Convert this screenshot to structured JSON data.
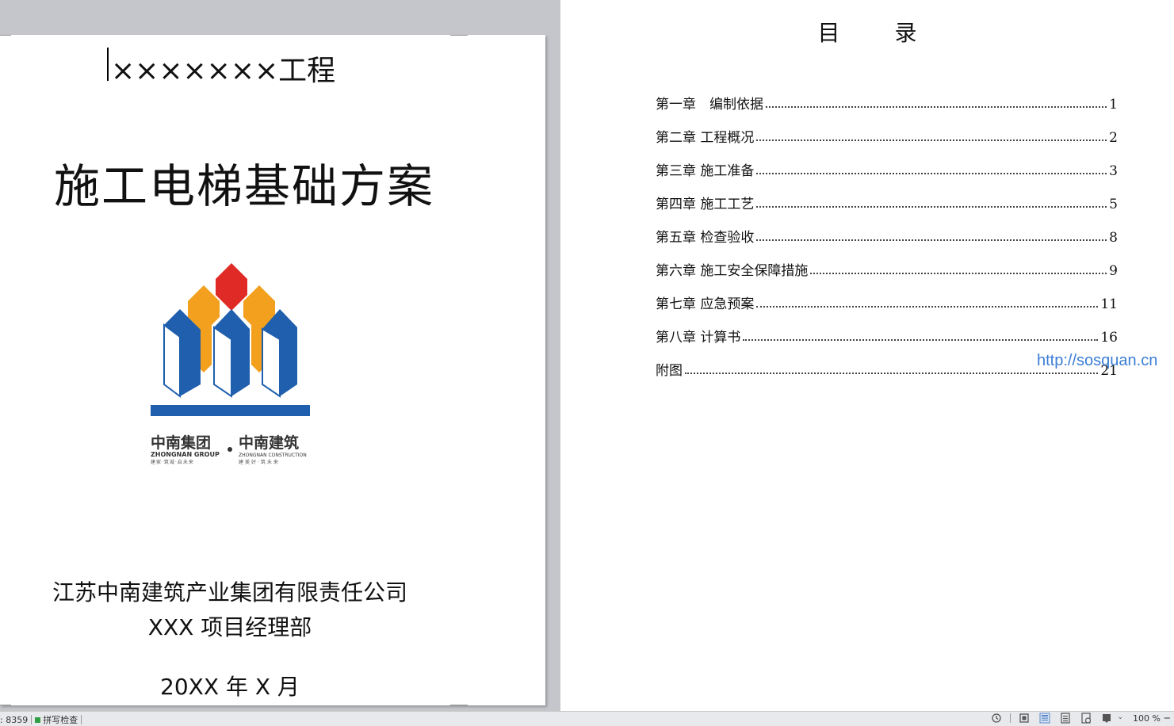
{
  "cover": {
    "project": "×××××××工程",
    "title": "施工电梯基础方案",
    "company": "江苏中南建筑产业集团有限责任公司",
    "department": "XXX 项目经理部",
    "date": "20XX 年 X 月",
    "logo": {
      "group_cn": "中南集团",
      "group_en": "ZHONGNAN GROUP",
      "group_slogan": "建家·筑城·启未来",
      "construction_cn": "中南建筑",
      "construction_en": "ZHONGNAN CONSTRUCTION",
      "construction_slogan": "建美好·筑未来",
      "colors": {
        "blue": "#1f5fad",
        "orange": "#f2a01e",
        "red": "#e02a26"
      }
    }
  },
  "toc": {
    "title": "目 录",
    "items": [
      {
        "label": "第一章　编制依据",
        "page": "1"
      },
      {
        "label": "第二章 工程概况",
        "page": "2"
      },
      {
        "label": "第三章 施工准备",
        "page": "3"
      },
      {
        "label": "第四章 施工工艺",
        "page": "5"
      },
      {
        "label": "第五章 检查验收",
        "page": "8"
      },
      {
        "label": "第六章 施工安全保障措施",
        "page": "9"
      },
      {
        "label": "第七章 应急预案",
        "page": "11"
      },
      {
        "label": "第八章 计算书",
        "page": "16"
      },
      {
        "label": "附图",
        "page": "21"
      }
    ]
  },
  "watermark": "http://sosquan.cn",
  "statusbar": {
    "word_count": ": 8359",
    "spell_check": "拼写检查",
    "zoom": "100 %"
  }
}
